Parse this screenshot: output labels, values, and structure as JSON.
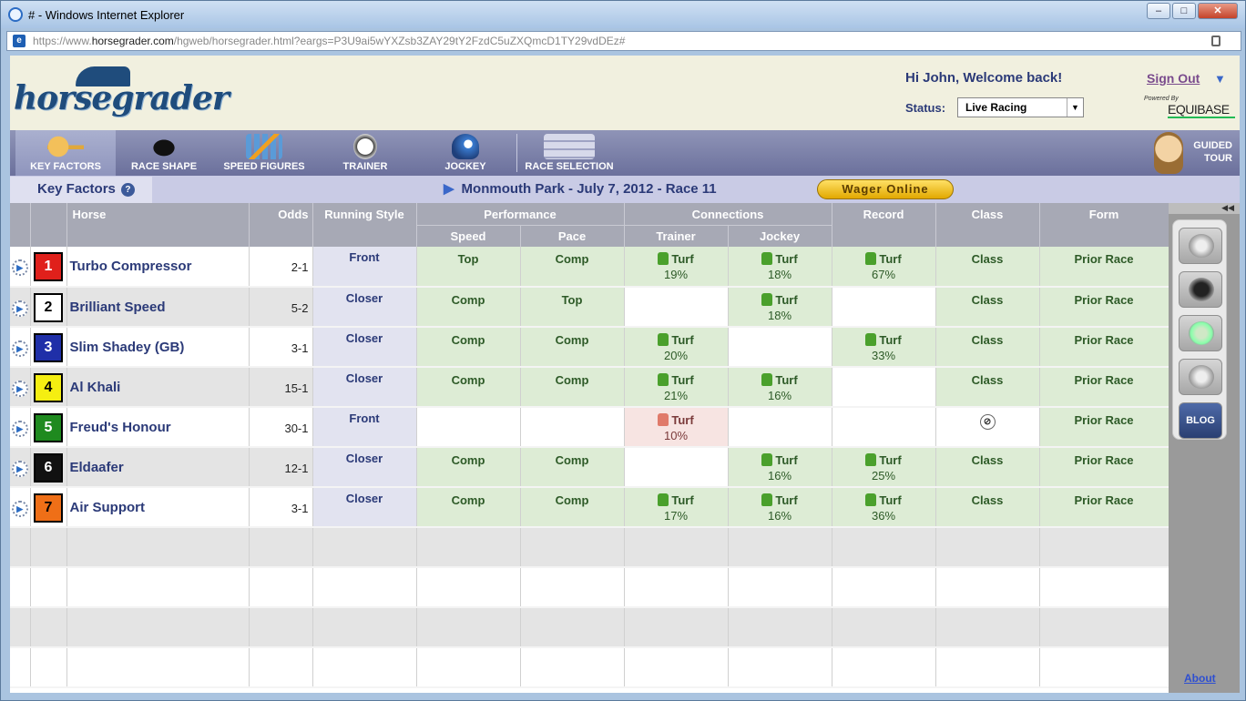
{
  "window": {
    "title": "# - Windows Internet Explorer",
    "controls": [
      "–",
      "□",
      "✕"
    ]
  },
  "address": {
    "prefix": "https://www.",
    "domain": "horsegrader.com",
    "path": "/hgweb/horsegrader.html?eargs=P3U9ai5wYXZsb3ZAY29tY2FzdC5uZXQmcD1TY29vdDEz#"
  },
  "header": {
    "logo": "horsegrader",
    "welcome": "Hi John, Welcome back!",
    "signout": "Sign Out",
    "status_label": "Status:",
    "status_value": "Live Racing",
    "powered_by": "Powered By",
    "equibase": "EQUIBASE"
  },
  "nav": {
    "items": [
      {
        "label": "KEY FACTORS",
        "icon": "key-icon"
      },
      {
        "label": "RACE SHAPE",
        "icon": "horse-icon"
      },
      {
        "label": "SPEED FIGURES",
        "icon": "chart-icon"
      },
      {
        "label": "TRAINER",
        "icon": "stopwatch-icon"
      },
      {
        "label": "JOCKEY",
        "icon": "helmet-icon"
      },
      {
        "label": "RACE SELECTION",
        "icon": "checklist-icon"
      }
    ],
    "guided_line1": "GUIDED",
    "guided_line2": "TOUR"
  },
  "subbar": {
    "tab": "Key Factors",
    "help": "?",
    "race": "Monmouth Park - July 7, 2012 - Race 11",
    "wager": "Wager Online"
  },
  "table": {
    "headers": {
      "horse": "Horse",
      "odds": "Odds",
      "running_style": "Running Style",
      "performance": "Performance",
      "connections": "Connections",
      "record": "Record",
      "class": "Class",
      "form": "Form",
      "speed": "Speed",
      "pace": "Pace",
      "trainer": "Trainer",
      "jockey": "Jockey"
    },
    "rows": [
      {
        "pp": "1",
        "horse": "Turbo Compressor",
        "odds": "2-1",
        "style": "Front",
        "speed": "Top",
        "pace": "Comp",
        "trainer": "Turf",
        "trainer_pct": "19%",
        "jockey": "Turf",
        "jockey_pct": "18%",
        "record": "Turf",
        "record_pct": "67%",
        "class": "Class",
        "form": "Prior Race"
      },
      {
        "pp": "2",
        "horse": "Brilliant Speed",
        "odds": "5-2",
        "style": "Closer",
        "speed": "Comp",
        "pace": "Top",
        "trainer": "",
        "trainer_pct": "",
        "jockey": "Turf",
        "jockey_pct": "18%",
        "record": "",
        "record_pct": "",
        "class": "Class",
        "form": "Prior Race"
      },
      {
        "pp": "3",
        "horse": "Slim Shadey (GB)",
        "odds": "3-1",
        "style": "Closer",
        "speed": "Comp",
        "pace": "Comp",
        "trainer": "Turf",
        "trainer_pct": "20%",
        "jockey": "",
        "jockey_pct": "",
        "record": "Turf",
        "record_pct": "33%",
        "class": "Class",
        "form": "Prior Race"
      },
      {
        "pp": "4",
        "horse": "Al Khali",
        "odds": "15-1",
        "style": "Closer",
        "speed": "Comp",
        "pace": "Comp",
        "trainer": "Turf",
        "trainer_pct": "21%",
        "jockey": "Turf",
        "jockey_pct": "16%",
        "record": "",
        "record_pct": "",
        "class": "Class",
        "form": "Prior Race"
      },
      {
        "pp": "5",
        "horse": "Freud's Honour",
        "odds": "30-1",
        "style": "Front",
        "speed": "",
        "pace": "",
        "trainer": "Turf",
        "trainer_pct": "10%",
        "jockey": "",
        "jockey_pct": "",
        "record": "",
        "record_pct": "",
        "class": "",
        "form": "Prior Race"
      },
      {
        "pp": "6",
        "horse": "Eldaafer",
        "odds": "12-1",
        "style": "Closer",
        "speed": "Comp",
        "pace": "Comp",
        "trainer": "",
        "trainer_pct": "",
        "jockey": "Turf",
        "jockey_pct": "16%",
        "record": "Turf",
        "record_pct": "25%",
        "class": "Class",
        "form": "Prior Race"
      },
      {
        "pp": "7",
        "horse": "Air Support",
        "odds": "3-1",
        "style": "Closer",
        "speed": "Comp",
        "pace": "Comp",
        "trainer": "Turf",
        "trainer_pct": "17%",
        "jockey": "Turf",
        "jockey_pct": "16%",
        "record": "Turf",
        "record_pct": "36%",
        "class": "Class",
        "form": "Prior Race"
      }
    ]
  },
  "pp_colors": {
    "1": "#e0201b",
    "2": "#ffffff",
    "3": "#1f2fa8",
    "4": "#f5ee11",
    "5": "#1f8a1f",
    "6": "#111111",
    "7": "#ef6f17"
  },
  "pp_text_colors": {
    "1": "#ffffff",
    "2": "#000000",
    "3": "#ffffff",
    "4": "#000000",
    "5": "#ffffff",
    "6": "#ffffff",
    "7": "#000000"
  },
  "sidebar": {
    "collapse": "◀◀",
    "blog": "BLOG",
    "about": "About"
  }
}
